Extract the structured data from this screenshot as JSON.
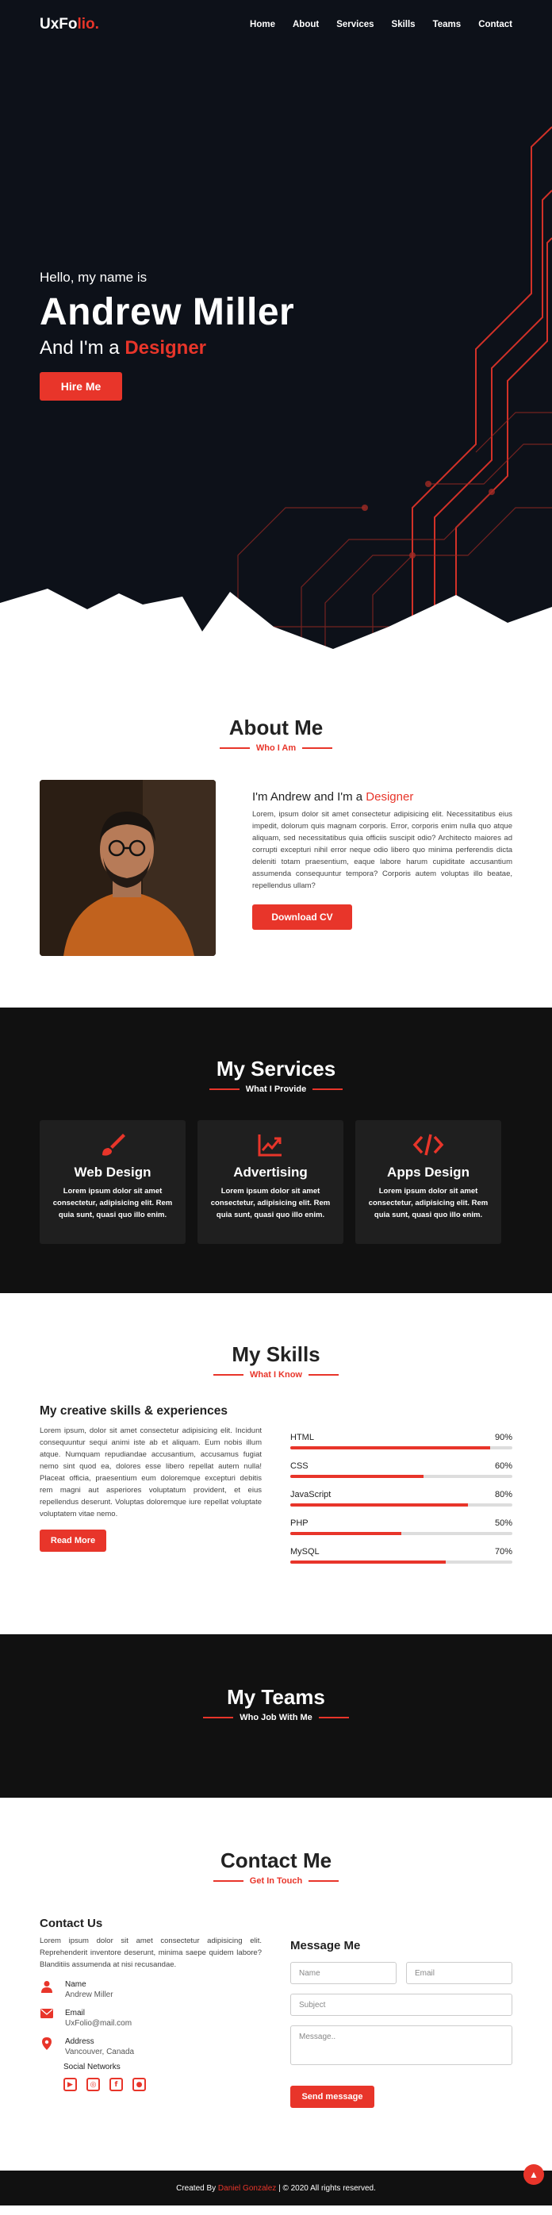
{
  "nav": {
    "logo_main": "UxFo",
    "logo_accent": "lio.",
    "items": [
      "Home",
      "About",
      "Services",
      "Skills",
      "Teams",
      "Contact"
    ]
  },
  "hero": {
    "greeting": "Hello, my name is",
    "name": "Andrew Miller",
    "role_prefix": "And I'm a",
    "role": "Designer",
    "cta": "Hire Me"
  },
  "about": {
    "title": "About Me",
    "subtitle": "Who I Am",
    "heading_prefix": "I'm Andrew and I'm a",
    "heading_role": "Designer",
    "text": "Lorem, ipsum dolor sit amet consectetur adipisicing elit. Necessitatibus eius impedit, dolorum quis magnam corporis. Error, corporis enim nulla quo atque aliquam, sed necessitatibus quia officiis suscipit odio? Architecto maiores ad corrupti excepturi nihil error neque odio libero quo minima perferendis dicta deleniti totam praesentium, eaque labore harum cupiditate accusantium assumenda consequuntur tempora? Corporis autem voluptas illo beatae, repellendus ullam?",
    "cta": "Download CV"
  },
  "services": {
    "title": "My Services",
    "subtitle": "What I Provide",
    "items": [
      {
        "icon": "paint-brush-icon",
        "title": "Web Design",
        "text": "Lorem ipsum dolor sit amet consectetur, adipisicing elit. Rem quia sunt, quasi quo illo enim."
      },
      {
        "icon": "chart-line-icon",
        "title": "Advertising",
        "text": "Lorem ipsum dolor sit amet consectetur, adipisicing elit. Rem quia sunt, quasi quo illo enim."
      },
      {
        "icon": "code-icon",
        "title": "Apps Design",
        "text": "Lorem ipsum dolor sit amet consectetur, adipisicing elit. Rem quia sunt, quasi quo illo enim."
      }
    ]
  },
  "skills": {
    "title": "My Skills",
    "subtitle": "What I Know",
    "heading": "My creative skills & experiences",
    "text": "Lorem ipsum, dolor sit amet consectetur adipisicing elit. Incidunt consequuntur sequi animi iste ab et aliquam. Eum nobis illum atque. Numquam repudiandae accusantium, accusamus fugiat nemo sint quod ea, dolores esse libero repellat autem nulla! Placeat officia, praesentium eum doloremque excepturi debitis rem magni aut asperiores voluptatum provident, et eius repellendus deserunt. Voluptas doloremque iure repellat voluptate voluptatem vitae nemo.",
    "cta": "Read More",
    "bars": [
      {
        "name": "HTML",
        "label": "90%",
        "value": 90
      },
      {
        "name": "CSS",
        "label": "60%",
        "value": 60
      },
      {
        "name": "JavaScript",
        "label": "80%",
        "value": 80
      },
      {
        "name": "PHP",
        "label": "50%",
        "value": 50
      },
      {
        "name": "MySQL",
        "label": "70%",
        "value": 70
      }
    ]
  },
  "teams": {
    "title": "My Teams",
    "subtitle": "Who Job With Me"
  },
  "contact": {
    "title": "Contact Me",
    "subtitle": "Get In Touch",
    "heading": "Contact Us",
    "text": "Lorem ipsum dolor sit amet consectetur adipisicing elit. Reprehenderit inventore deserunt, minima saepe quidem labore? Blanditiis assumenda at nisi recusandae.",
    "name_label": "Name",
    "name_value": "Andrew Miller",
    "email_label": "Email",
    "email_value": "UxFolio@mail.com",
    "address_label": "Address",
    "address_value": "Vancouver, Canada",
    "social_label": "Social Networks",
    "form_heading": "Message Me",
    "ph_name": "Name",
    "ph_email": "Email",
    "ph_subject": "Subject",
    "ph_message": "Message..",
    "send": "Send message"
  },
  "footer": {
    "prefix": "Created By",
    "author": "Daniel Gonzalez",
    "suffix": "| © 2020 All rights reserved."
  },
  "colors": {
    "accent": "#e8352a",
    "dark": "#0d1119",
    "section_dark": "#111111"
  }
}
